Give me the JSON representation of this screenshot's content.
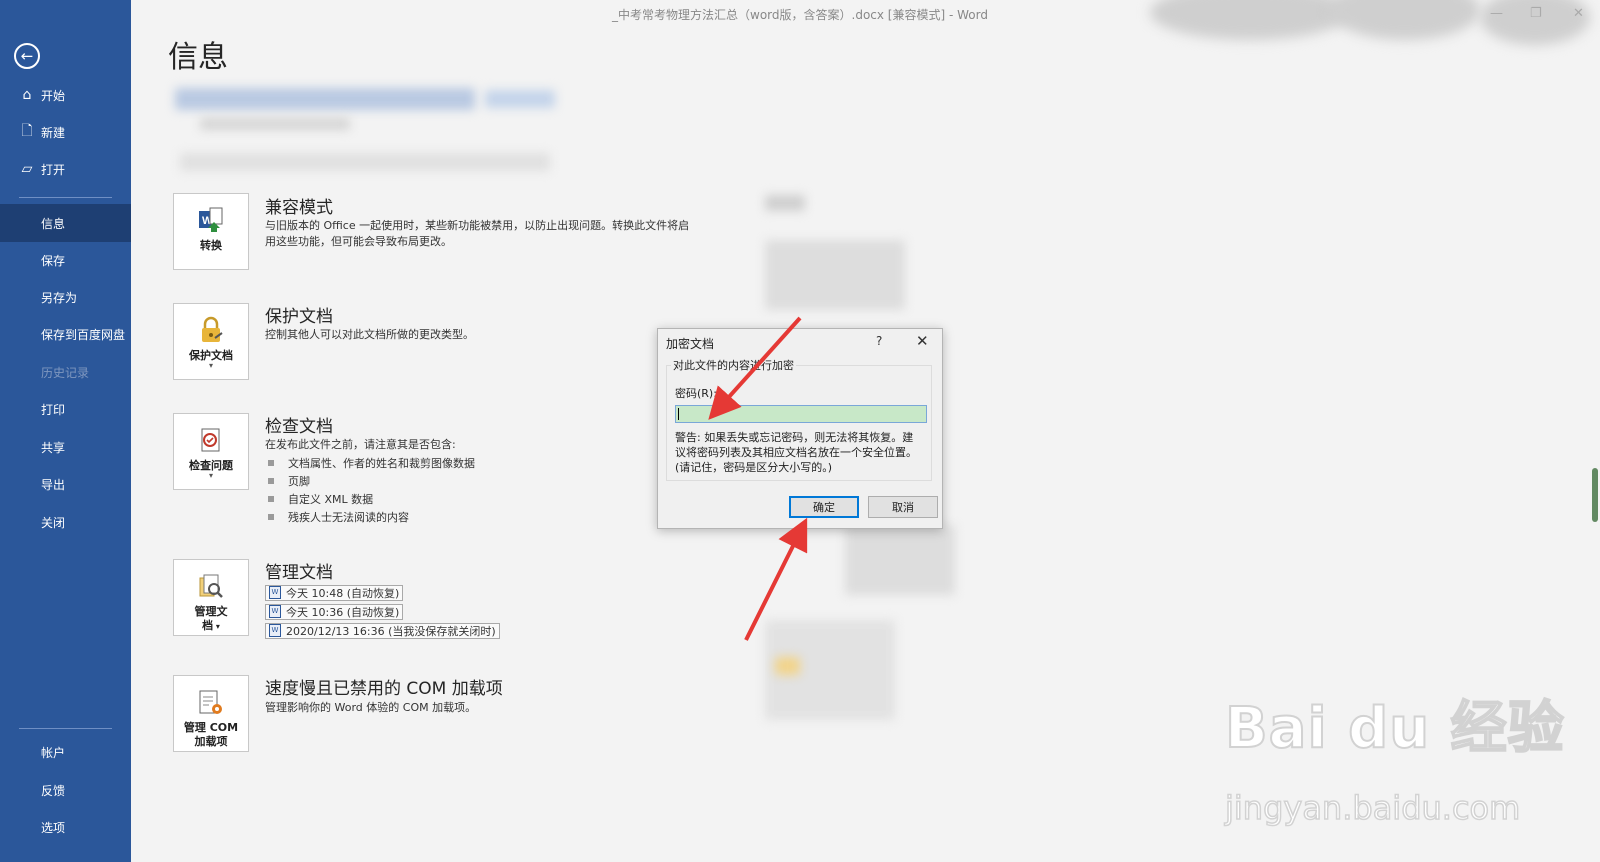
{
  "window": {
    "title": "_中考常考物理方法汇总（word版，含答案）.docx [兼容模式] - Word"
  },
  "sidebar": {
    "top_items": [
      {
        "label": "开始",
        "icon": "home-icon"
      },
      {
        "label": "新建",
        "icon": "new-document-icon"
      },
      {
        "label": "打开",
        "icon": "open-folder-icon"
      }
    ],
    "items": [
      {
        "label": "信息",
        "active": true
      },
      {
        "label": "保存"
      },
      {
        "label": "另存为"
      },
      {
        "label": "保存到百度网盘"
      },
      {
        "label": "历史记录",
        "disabled": true
      },
      {
        "label": "打印"
      },
      {
        "label": "共享"
      },
      {
        "label": "导出"
      },
      {
        "label": "关闭"
      }
    ],
    "bottom_items": [
      {
        "label": "帐户"
      },
      {
        "label": "反馈"
      },
      {
        "label": "选项"
      }
    ],
    "accent": "#2b579a"
  },
  "page": {
    "title": "信息",
    "sections": {
      "compat": {
        "button_label": "转换",
        "title": "兼容模式",
        "desc_line1": "与旧版本的 Office 一起使用时，某些新功能被禁用，以防止出现问题。转换此文件将启",
        "desc_line2": "用这些功能，但可能会导致布局更改。"
      },
      "protect": {
        "button_label": "保护文档",
        "title": "保护文档",
        "desc": "控制其他人可以对此文档所做的更改类型。"
      },
      "inspect": {
        "button_label": "检查问题",
        "title": "检查文档",
        "desc": "在发布此文件之前，请注意其是否包含:",
        "bullets": [
          "文档属性、作者的姓名和裁剪图像数据",
          "页脚",
          "自定义 XML 数据",
          "残疾人士无法阅读的内容"
        ]
      },
      "manage": {
        "button_label_1": "管理文",
        "button_label_2": "档",
        "title": "管理文档",
        "versions": [
          "今天 10:48 (自动恢复)",
          "今天 10:36 (自动恢复)",
          "2020/12/13 16:36 (当我没保存就关闭时)"
        ]
      },
      "com": {
        "button_label_1": "管理 COM",
        "button_label_2": "加载项",
        "title": "速度慢且已禁用的 COM 加载项",
        "desc": "管理影响你的 Word 体验的 COM 加载项。"
      }
    }
  },
  "dialog": {
    "title": "加密文档",
    "help": "?",
    "group_label": "对此文件的内容进行加密",
    "password_label": "密码(R):",
    "password_value": "",
    "warning_line1": "警告: 如果丢失或忘记密码，则无法将其恢复。建",
    "warning_line2": "议将密码列表及其相应文档名放在一个安全位置。",
    "warning_line3": "(请记住，密码是区分大小写的。)",
    "ok": "确定",
    "cancel": "取消"
  },
  "watermark": {
    "brand": "Bai du 经验",
    "url": "jingyan.baidu.com"
  }
}
